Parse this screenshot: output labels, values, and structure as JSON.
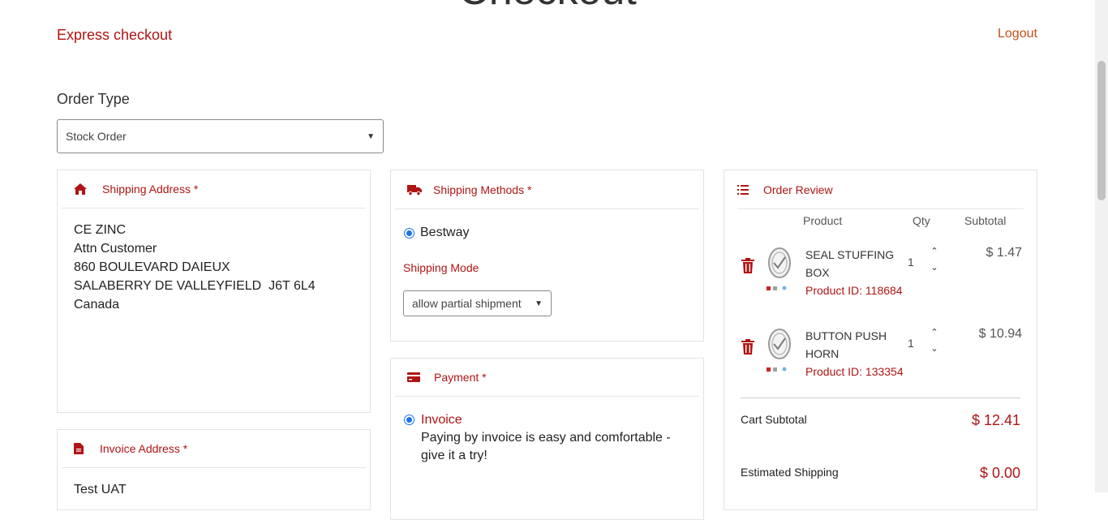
{
  "page_title": "Checkout",
  "express_checkout": "Express checkout",
  "logout": "Logout",
  "order_type": {
    "label": "Order Type",
    "selected": "Stock Order"
  },
  "shipping_address": {
    "title": "Shipping Address *",
    "lines": [
      "CE ZINC",
      "Attn Customer",
      "860 BOULEVARD DAIEUX",
      "SALABERRY DE VALLEYFIELD  J6T 6L4",
      "Canada"
    ]
  },
  "invoice_address": {
    "title": "Invoice Address *",
    "first_line": "Test UAT"
  },
  "shipping_methods": {
    "title": "Shipping Methods *",
    "option": "Bestway",
    "mode_label": "Shipping Mode",
    "mode_selected": "allow partial shipment"
  },
  "payment": {
    "title": "Payment *",
    "option": "Invoice",
    "description": "Paying by invoice is easy and comfortable - give it a try!"
  },
  "order_review": {
    "title": "Order Review",
    "columns": {
      "product": "Product",
      "qty": "Qty",
      "subtotal": "Subtotal"
    },
    "items": [
      {
        "name": "SEAL STUFFING BOX",
        "product_id": "Product ID: 118684",
        "qty": "1",
        "price": "$ 1.47"
      },
      {
        "name": "BUTTON PUSH HORN",
        "product_id": "Product ID: 133354",
        "qty": "1",
        "price": "$ 10.94"
      }
    ],
    "cart_subtotal_label": "Cart Subtotal",
    "cart_subtotal": "$ 12.41",
    "est_shipping_label": "Estimated Shipping",
    "est_shipping": "$ 0.00"
  },
  "colors": {
    "accent": "#b01414",
    "radio": "#1a73e8"
  }
}
